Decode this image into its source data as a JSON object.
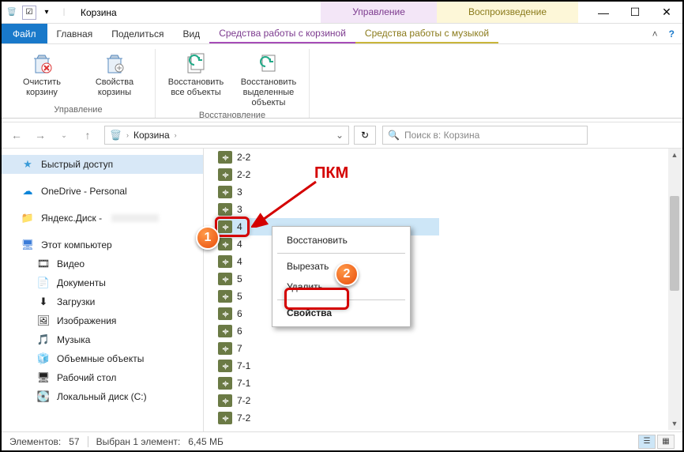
{
  "title": "Корзина",
  "context_tabs": {
    "manage": "Управление",
    "playback": "Воспроизведение"
  },
  "context_subtabs": {
    "bin": "Средства работы с корзиной",
    "music": "Средства работы с музыкой"
  },
  "menu": {
    "file": "Файл",
    "home": "Главная",
    "share": "Поделиться",
    "view": "Вид"
  },
  "ribbon": {
    "empty_bin": "Очистить корзину",
    "bin_props": "Свойства корзины",
    "restore_all": "Восстановить все объекты",
    "restore_sel": "Восстановить выделенные объекты",
    "group_manage": "Управление",
    "group_restore": "Восстановление"
  },
  "breadcrumb": {
    "root": "Корзина"
  },
  "search_placeholder": "Поиск в: Корзина",
  "sidebar": {
    "quick": "Быстрый доступ",
    "onedrive": "OneDrive - Personal",
    "yandex": "Яндекс.Диск -",
    "thispc": "Этот компьютер",
    "video": "Видео",
    "documents": "Документы",
    "downloads": "Загрузки",
    "pictures": "Изображения",
    "music": "Музыка",
    "objects3d": "Объемные объекты",
    "desktop": "Рабочий стол",
    "cdrive": "Локальный диск (C:)"
  },
  "files": [
    "2-2",
    "2-2",
    "3",
    "3",
    "4",
    "4",
    "4",
    "5",
    "5",
    "6",
    "6",
    "7",
    "7-1",
    "7-1",
    "7-2",
    "7-2"
  ],
  "context_menu": {
    "restore": "Восстановить",
    "cut": "Вырезать",
    "delete": "Удалить",
    "properties": "Свойства"
  },
  "annotations": {
    "pkm": "ПКМ",
    "step1": "1",
    "step2": "2"
  },
  "status": {
    "count_label": "Элементов:",
    "count": "57",
    "sel_label": "Выбран 1 элемент:",
    "sel_size": "6,45 МБ"
  }
}
